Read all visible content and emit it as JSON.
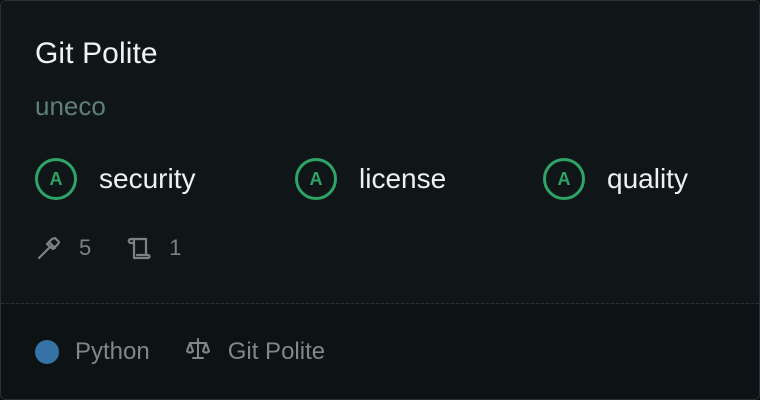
{
  "card": {
    "title": "Git Polite",
    "owner": "uneco",
    "grades": [
      {
        "grade": "A",
        "label": "security"
      },
      {
        "grade": "A",
        "label": "license"
      },
      {
        "grade": "A",
        "label": "quality"
      }
    ],
    "stats": {
      "builds": "5",
      "docs": "1"
    },
    "footer": {
      "language": "Python",
      "language_color": "#3572a5",
      "license": "Git Polite"
    },
    "icons": {
      "builds": "hammer-icon",
      "docs": "scroll-icon",
      "license": "scale-icon"
    },
    "colors": {
      "grade_accent": "#2ea366"
    }
  }
}
